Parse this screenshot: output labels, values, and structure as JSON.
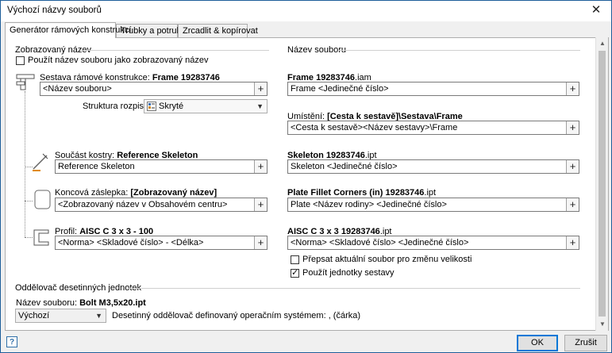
{
  "window": {
    "title": "Výchozí názvy souborů",
    "close_glyph": "✕"
  },
  "tabs": [
    {
      "label": "Generátor rámových konstrukcí",
      "active": true
    },
    {
      "label": "Trubky a potrubí",
      "active": false
    },
    {
      "label": "Zrcadlit & kopírovat",
      "active": false
    }
  ],
  "left": {
    "section_title": "Zobrazovaný název",
    "use_filename_checkbox": {
      "label": "Použít název souboru jako zobrazovaný název",
      "checked": false
    },
    "assembly": {
      "label_prefix": "Sestava rámové konstrukce: ",
      "label_bold": "Frame 19283746",
      "value": "<Název souboru>",
      "icon": "frame-assembly-icon"
    },
    "bom": {
      "label": "Struktura rozpisky",
      "value": "Skryté",
      "icon": "bom-structure-icon"
    },
    "skeleton": {
      "label_prefix": "Součást kostry: ",
      "label_bold": "Reference Skeleton",
      "value": "Reference Skeleton",
      "icon": "skeleton-sketch-icon"
    },
    "endcap": {
      "label_prefix": "Koncová záslepka: ",
      "label_bold": "[Zobrazovaný název]",
      "value": "<Zobrazovaný název v Obsahovém centru>",
      "icon": "end-cap-icon"
    },
    "profile": {
      "label_prefix": "Profil: ",
      "label_bold": "AISC C 3 x 3 - 100",
      "value": "<Norma> <Skladové číslo> - <Délka>",
      "icon": "c-profile-icon"
    }
  },
  "right": {
    "section_title": "Název souboru",
    "assembly": {
      "label_bold": "Frame 19283746",
      "label_suffix": ".iam",
      "value": "Frame <Jedinečné číslo>"
    },
    "location": {
      "label_prefix": "Umístění: ",
      "label_bold": "[Cesta k sestavě]\\Sestava\\Frame",
      "value": "<Cesta k sestavě><Název sestavy>\\Frame"
    },
    "skeleton": {
      "label_bold": "Skeleton 19283746",
      "label_suffix": ".ipt",
      "value": "Skeleton <Jedinečné číslo>"
    },
    "endcap": {
      "label_bold": "Plate Fillet Corners (in) 19283746",
      "label_suffix": ".ipt",
      "value": "Plate <Název rodiny> <Jedinečné číslo>"
    },
    "profile": {
      "label_bold": "AISC C 3 x 3 19283746",
      "label_suffix": ".ipt",
      "value": "<Norma> <Skladové číslo> <Jedinečné číslo>"
    },
    "overwrite_checkbox": {
      "label": "Přepsat aktuální soubor pro změnu velikosti",
      "checked": false
    },
    "units_checkbox": {
      "label": "Použít jednotky sestavy",
      "checked": true
    }
  },
  "decimal": {
    "section_title": "Oddělovač desetinných jednotek",
    "filename_label_prefix": "Název souboru: ",
    "filename_label_bold": "Bolt M3,5x20.ipt",
    "select_value": "Výchozí",
    "description": "Desetinný oddělovač definovaný operačním systémem: , (čárka)"
  },
  "plus_glyph": "+",
  "footer": {
    "help_glyph": "?",
    "ok_label": "OK",
    "cancel_label": "Zrušit"
  }
}
